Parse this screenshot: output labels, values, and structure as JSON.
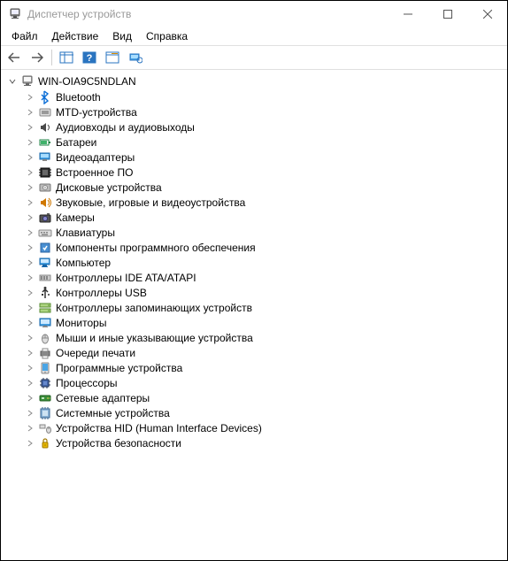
{
  "window": {
    "title": "Диспетчер устройств"
  },
  "menu": {
    "file": "Файл",
    "action": "Действие",
    "view": "Вид",
    "help": "Справка"
  },
  "tree": {
    "root_label": "WIN-OIA9C5NDLAN",
    "items": [
      {
        "label": "Bluetooth",
        "icon": "bluetooth"
      },
      {
        "label": "MTD-устройства",
        "icon": "mtd"
      },
      {
        "label": "Аудиовходы и аудиовыходы",
        "icon": "audio"
      },
      {
        "label": "Батареи",
        "icon": "battery"
      },
      {
        "label": "Видеоадаптеры",
        "icon": "display-adapter"
      },
      {
        "label": "Встроенное ПО",
        "icon": "firmware"
      },
      {
        "label": "Дисковые устройства",
        "icon": "disk"
      },
      {
        "label": "Звуковые, игровые и видеоустройства",
        "icon": "sound"
      },
      {
        "label": "Камеры",
        "icon": "camera"
      },
      {
        "label": "Клавиатуры",
        "icon": "keyboard"
      },
      {
        "label": "Компоненты программного обеспечения",
        "icon": "software"
      },
      {
        "label": "Компьютер",
        "icon": "computer"
      },
      {
        "label": "Контроллеры IDE ATA/ATAPI",
        "icon": "ide"
      },
      {
        "label": "Контроллеры USB",
        "icon": "usb"
      },
      {
        "label": "Контроллеры запоминающих устройств",
        "icon": "storage-controller"
      },
      {
        "label": "Мониторы",
        "icon": "monitor"
      },
      {
        "label": "Мыши и иные указывающие устройства",
        "icon": "mouse"
      },
      {
        "label": "Очереди печати",
        "icon": "print-queue"
      },
      {
        "label": "Программные устройства",
        "icon": "software-device"
      },
      {
        "label": "Процессоры",
        "icon": "processor"
      },
      {
        "label": "Сетевые адаптеры",
        "icon": "network"
      },
      {
        "label": "Системные устройства",
        "icon": "system"
      },
      {
        "label": "Устройства HID (Human Interface Devices)",
        "icon": "hid"
      },
      {
        "label": "Устройства безопасности",
        "icon": "security"
      }
    ]
  }
}
